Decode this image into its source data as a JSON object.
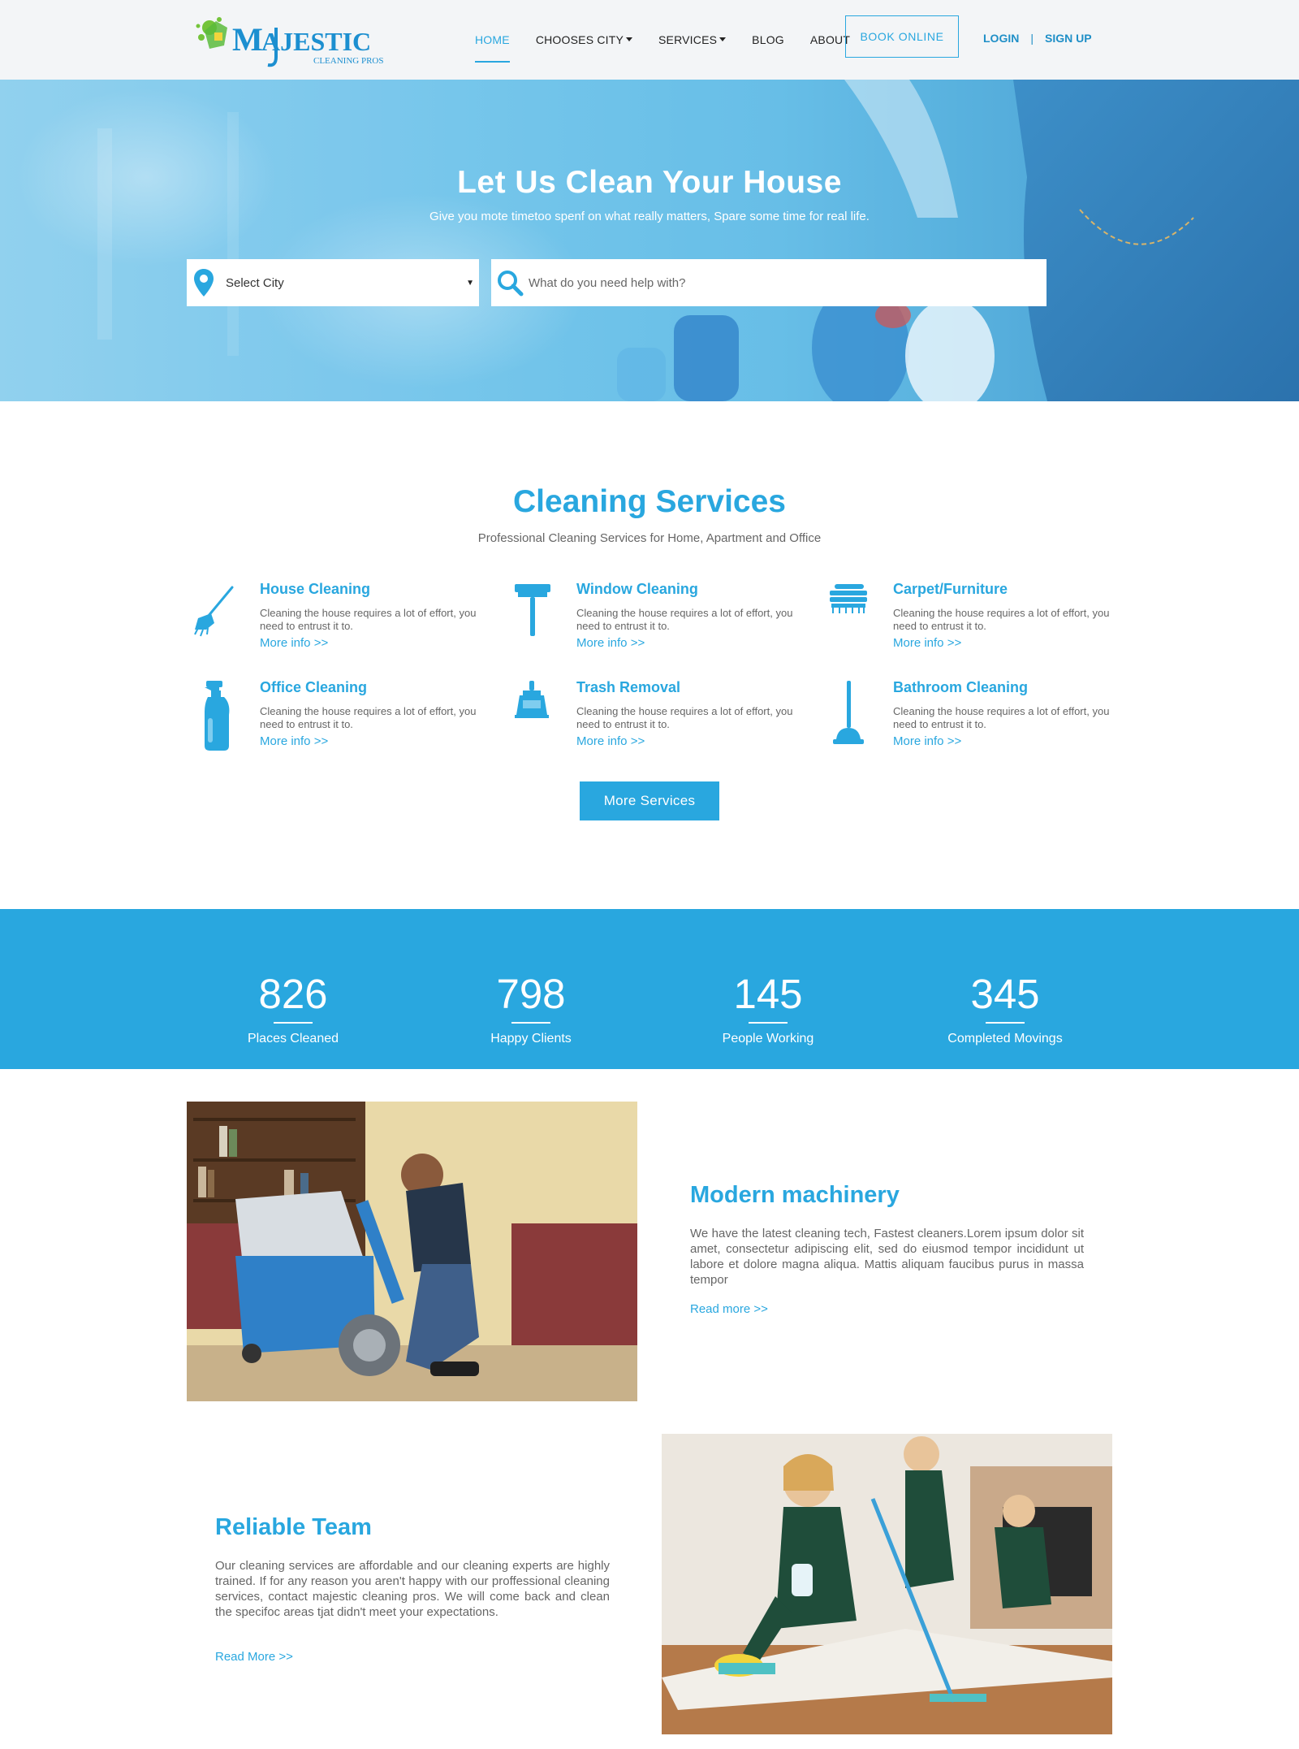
{
  "brand": {
    "logo_text": "MAJESTIC",
    "logo_subtext": "CLEANING PROS",
    "accent_color": "#29a7df"
  },
  "nav": {
    "items": [
      {
        "label": "HOME",
        "active": true,
        "dropdown": false
      },
      {
        "label": "CHOOSES CITY",
        "active": false,
        "dropdown": true
      },
      {
        "label": "SERVICES",
        "active": false,
        "dropdown": true
      },
      {
        "label": "BLOG",
        "active": false,
        "dropdown": false
      },
      {
        "label": "ABOUT",
        "active": false,
        "dropdown": false
      }
    ],
    "book_online": "BOOK ONLINE",
    "login": "LOGIN",
    "separator": "|",
    "signup": "SIGN UP"
  },
  "hero": {
    "title": "Let Us Clean Your House",
    "subtitle": "Give you mote timetoo spenf on what really matters, Spare some time for real life.",
    "city_select": {
      "value": "Select City",
      "icon": "location-pin-icon"
    },
    "search": {
      "placeholder": "What do you need help with?",
      "icon": "search-icon"
    }
  },
  "services": {
    "title": "Cleaning Services",
    "subtitle": "Professional Cleaning Services for Home, Apartment and Office",
    "items": [
      {
        "name": "House Cleaning",
        "desc": "Cleaning the house requires a lot of effort, you need to entrust it to.",
        "more": "More info >>",
        "icon": "broom-icon"
      },
      {
        "name": "Window Cleaning",
        "desc": "Cleaning the house requires a lot of effort, you need to entrust it to.",
        "more": "More info >>",
        "icon": "squeegee-icon"
      },
      {
        "name": "Carpet/Furniture",
        "desc": "Cleaning the house requires a lot of effort, you need to entrust it to.",
        "more": "More info >>",
        "icon": "brush-icon"
      },
      {
        "name": "Office Cleaning",
        "desc": "Cleaning the house requires a lot of effort, you need to entrust it to.",
        "more": "More info >>",
        "icon": "spray-bottle-icon"
      },
      {
        "name": "Trash Removal",
        "desc": "Cleaning the house requires a lot of effort, you need to entrust it to.",
        "more": "More info >>",
        "icon": "dustpan-icon"
      },
      {
        "name": "Bathroom Cleaning",
        "desc": "Cleaning the house requires a lot of effort, you need to entrust it to.",
        "more": "More info >>",
        "icon": "plunger-icon"
      }
    ],
    "more_button": "More Services"
  },
  "stats": [
    {
      "value": "826",
      "label": "Places Cleaned"
    },
    {
      "value": "798",
      "label": "Happy Clients"
    },
    {
      "value": "145",
      "label": "People Working"
    },
    {
      "value": "345",
      "label": "Completed Movings"
    }
  ],
  "features": [
    {
      "title": "Modern machinery",
      "text": "We have the latest cleaning tech, Fastest cleaners.Lorem ipsum dolor sit amet, consectetur adipiscing elit, sed do eiusmod tempor incididunt ut labore et dolore magna aliqua. Mattis aliquam faucibus purus in massa tempor",
      "link": "Read more >>"
    },
    {
      "title": "Reliable Team",
      "text": "Our cleaning services are affordable and our cleaning experts are highly trained. If for any reason you aren't happy with our proffessional cleaning services, contact majestic cleaning pros. We will come back and clean the specifoc areas tjat didn't meet your expectations.",
      "link": "Read More >>"
    }
  ]
}
